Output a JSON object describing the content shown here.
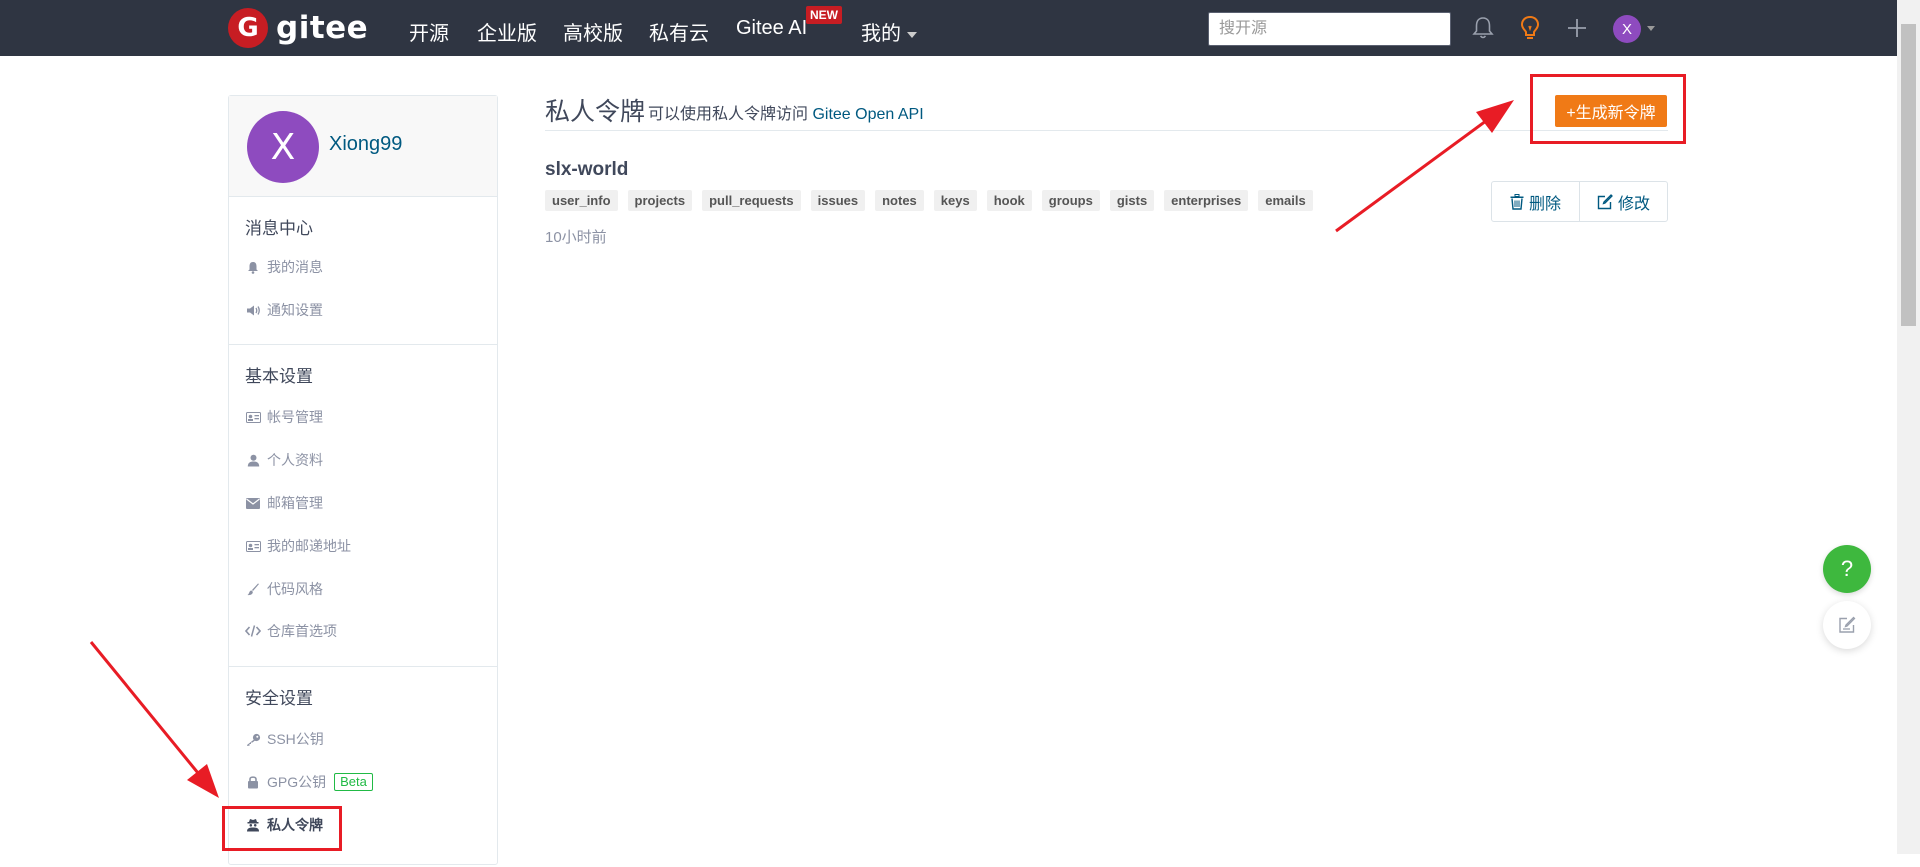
{
  "header": {
    "logo_text": "gitee",
    "logo_mark": "G",
    "nav": [
      "开源",
      "企业版",
      "高校版",
      "私有云",
      "Gitee AI",
      "我的"
    ],
    "new_badge": "NEW",
    "search_placeholder": "搜开源",
    "avatar_letter": "X",
    "icons": [
      "bell-icon",
      "lightbulb-icon",
      "plus-icon"
    ]
  },
  "sidebar": {
    "user": {
      "avatar_letter": "X",
      "name": "Xiong99"
    },
    "sections": [
      {
        "title": "消息中心",
        "items": [
          {
            "label": "我的消息",
            "icon": "bell-icon"
          },
          {
            "label": "通知设置",
            "icon": "speaker-icon"
          }
        ]
      },
      {
        "title": "基本设置",
        "items": [
          {
            "label": "帐号管理",
            "icon": "id-card-icon"
          },
          {
            "label": "个人资料",
            "icon": "user-icon"
          },
          {
            "label": "邮箱管理",
            "icon": "envelope-icon"
          },
          {
            "label": "我的邮递地址",
            "icon": "address-card-icon"
          },
          {
            "label": "代码风格",
            "icon": "brush-icon"
          },
          {
            "label": "仓库首选项",
            "icon": "code-icon"
          }
        ]
      },
      {
        "title": "安全设置",
        "items": [
          {
            "label": "SSH公钥",
            "icon": "key-icon"
          },
          {
            "label": "GPG公钥",
            "icon": "lock-icon",
            "badge": "Beta"
          },
          {
            "label": "私人令牌",
            "icon": "user-secret-icon",
            "active": true
          }
        ]
      }
    ]
  },
  "main": {
    "title": "私人令牌",
    "subtitle_prefix": "可以使用私人令牌访问 ",
    "subtitle_link": "Gitee Open API",
    "generate_button": "+生成新令牌",
    "token": {
      "name": "slx-world",
      "scopes": [
        "user_info",
        "projects",
        "pull_requests",
        "issues",
        "notes",
        "keys",
        "hook",
        "groups",
        "gists",
        "enterprises",
        "emails"
      ],
      "time": "10小时前",
      "delete_label": "删除",
      "edit_label": "修改"
    }
  },
  "floating": {
    "help_label": "?"
  },
  "colors": {
    "header_bg": "#2f3542",
    "accent_orange": "#f07a16",
    "avatar_purple": "#8e4bbf",
    "link_blue": "#005980",
    "annotation_red": "#e81c25",
    "help_green": "#3eb83e"
  }
}
